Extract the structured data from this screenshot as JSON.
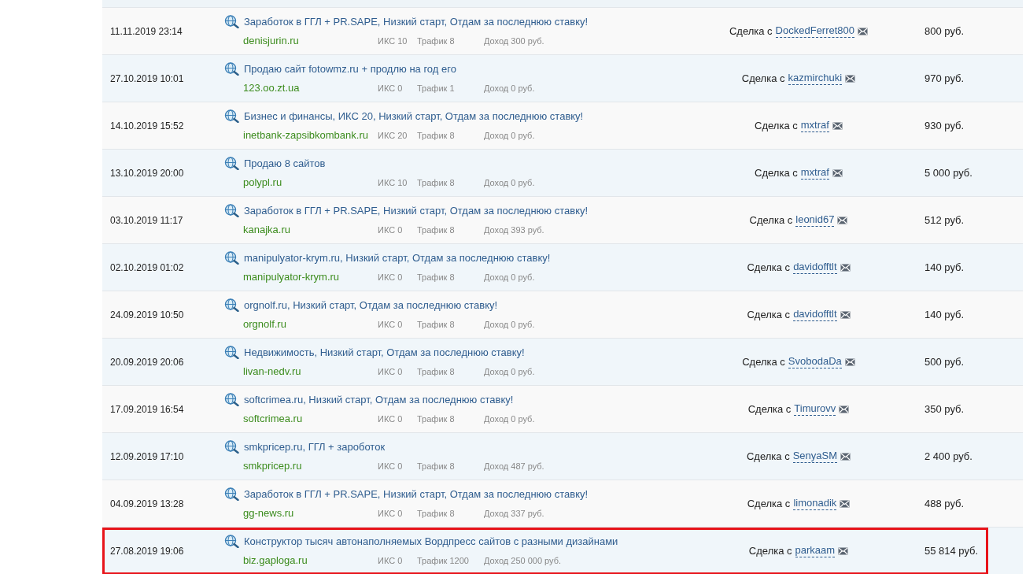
{
  "deals": [
    {
      "date": "11.11.2019 23:14",
      "title": "Заработок в ГГЛ + PR.SAPE, Низкий старт, Отдам за последнюю ставку!",
      "domain": "denisjurin.ru",
      "iks": "ИКС 10",
      "traffic": "Трафик 8",
      "income": "Доход 300 руб.",
      "deal_label": "Сделка с",
      "user": "DockedFerret800",
      "price": "800 руб.",
      "highlighted": false
    },
    {
      "date": "27.10.2019 10:01",
      "title": "Продаю сайт fotowmz.ru + продлю на год его",
      "domain": "123.oo.zt.ua",
      "iks": "ИКС 0",
      "traffic": "Трафик 1",
      "income": "Доход 0 руб.",
      "deal_label": "Сделка с",
      "user": "kazmirchuki",
      "price": "970 руб.",
      "highlighted": false
    },
    {
      "date": "14.10.2019 15:52",
      "title": "Бизнес и финансы, ИКС 20, Низкий старт, Отдам за последнюю ставку!",
      "domain": "inetbank-zapsibkombank.ru",
      "iks": "ИКС 20",
      "traffic": "Трафик 8",
      "income": "Доход 0 руб.",
      "deal_label": "Сделка с",
      "user": "mxtraf",
      "price": "930 руб.",
      "highlighted": false
    },
    {
      "date": "13.10.2019 20:00",
      "title": "Продаю 8 сайтов",
      "domain": "polypl.ru",
      "iks": "ИКС 10",
      "traffic": "Трафик 8",
      "income": "Доход 0 руб.",
      "deal_label": "Сделка с",
      "user": "mxtraf",
      "price": "5 000 руб.",
      "highlighted": false
    },
    {
      "date": "03.10.2019 11:17",
      "title": "Заработок в ГГЛ + PR.SAPE, Низкий старт, Отдам за последнюю ставку!",
      "domain": "kanajka.ru",
      "iks": "ИКС 0",
      "traffic": "Трафик 8",
      "income": "Доход 393 руб.",
      "deal_label": "Сделка с",
      "user": "leonid67",
      "price": "512 руб.",
      "highlighted": false
    },
    {
      "date": "02.10.2019 01:02",
      "title": "manipulyator-krym.ru, Низкий старт, Отдам за последнюю ставку!",
      "domain": "manipulyator-krym.ru",
      "iks": "ИКС 0",
      "traffic": "Трафик 8",
      "income": "Доход 0 руб.",
      "deal_label": "Сделка с",
      "user": "davidofftlt",
      "price": "140 руб.",
      "highlighted": false
    },
    {
      "date": "24.09.2019 10:50",
      "title": "orgnolf.ru, Низкий старт, Отдам за последнюю ставку!",
      "domain": "orgnolf.ru",
      "iks": "ИКС 0",
      "traffic": "Трафик 8",
      "income": "Доход 0 руб.",
      "deal_label": "Сделка с",
      "user": "davidofftlt",
      "price": "140 руб.",
      "highlighted": false
    },
    {
      "date": "20.09.2019 20:06",
      "title": "Недвижимость, Низкий старт, Отдам за последнюю ставку!",
      "domain": "livan-nedv.ru",
      "iks": "ИКС 0",
      "traffic": "Трафик 8",
      "income": "Доход 0 руб.",
      "deal_label": "Сделка с",
      "user": "SvobodaDa",
      "price": "500 руб.",
      "highlighted": false
    },
    {
      "date": "17.09.2019 16:54",
      "title": "softcrimea.ru, Низкий старт, Отдам за последнюю ставку!",
      "domain": "softcrimea.ru",
      "iks": "ИКС 0",
      "traffic": "Трафик 8",
      "income": "Доход 0 руб.",
      "deal_label": "Сделка с",
      "user": "Timurovv",
      "price": "350 руб.",
      "highlighted": false
    },
    {
      "date": "12.09.2019 17:10",
      "title": "smkpricep.ru, ГГЛ + зароботок",
      "domain": "smkpricep.ru",
      "iks": "ИКС 0",
      "traffic": "Трафик 8",
      "income": "Доход 487 руб.",
      "deal_label": "Сделка с",
      "user": "SenyaSM",
      "price": "2 400 руб.",
      "highlighted": false
    },
    {
      "date": "04.09.2019 13:28",
      "title": "Заработок в ГГЛ + PR.SAPE, Низкий старт, Отдам за последнюю ставку!",
      "domain": "gg-news.ru",
      "iks": "ИКС 0",
      "traffic": "Трафик 8",
      "income": "Доход 337 руб.",
      "deal_label": "Сделка с",
      "user": "limonadik",
      "price": "488 руб.",
      "highlighted": false
    },
    {
      "date": "27.08.2019 19:06",
      "title": "Конструктор тысяч автонаполняемых Вордпресс сайтов с разными дизайнами",
      "domain": "biz.gaploga.ru",
      "iks": "ИКС 0",
      "traffic": "Трафик 1200",
      "income": "Доход 250 000 руб.",
      "deal_label": "Сделка с",
      "user": "parkaam",
      "price": "55 814 руб.",
      "highlighted": true
    }
  ]
}
